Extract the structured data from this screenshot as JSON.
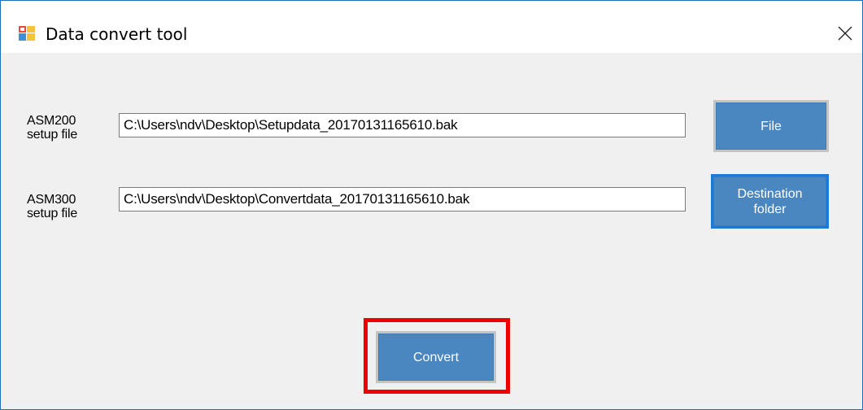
{
  "window": {
    "title": "Data convert tool",
    "icons": {
      "app": "app-window-icon",
      "close": "close-icon"
    }
  },
  "form": {
    "source": {
      "label_line1": "ASM200",
      "label_line2": "setup file",
      "value": "C:\\Users\\ndv\\Desktop\\Setupdata_20170131165610.bak",
      "button": "File"
    },
    "destination": {
      "label_line1": "ASM300",
      "label_line2": "setup file",
      "value": "C:\\Users\\ndv\\Desktop\\Convertdata_20170131165610.bak",
      "button_line1": "Destination",
      "button_line2": "folder"
    },
    "convert_button": "Convert"
  },
  "colors": {
    "button_fill": "#4a86c0",
    "focus_border": "#1e78d6",
    "highlight": "#ee0000",
    "window_border": "#1f6fb5",
    "background": "#f0f0f0"
  }
}
